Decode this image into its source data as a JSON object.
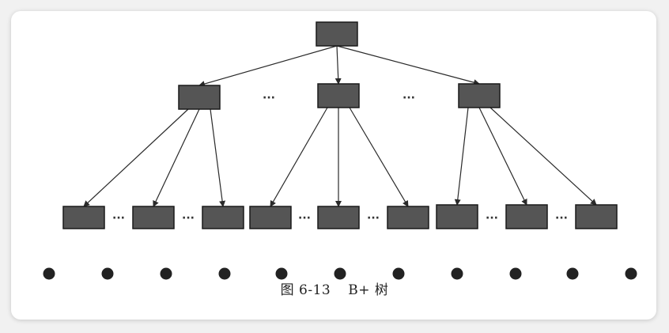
{
  "figure": {
    "caption_number": "图 6-13",
    "caption_title": "B+ 树"
  },
  "tree": {
    "node_color": "#555555",
    "node_border_color": "#1a1a1a",
    "edge_color": "#2a2a2a",
    "ellipsis": "···",
    "levels": [
      "root",
      "internal",
      "leaf",
      "records"
    ]
  }
}
